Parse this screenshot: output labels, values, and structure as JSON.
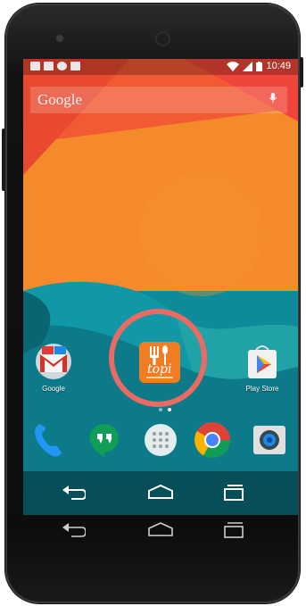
{
  "status_bar": {
    "time": "10:49",
    "left_icons": [
      "image-notification-icon",
      "email-notification-icon",
      "hangouts-notification-icon",
      "download-notification-icon"
    ],
    "right_icons": [
      "wifi-icon",
      "signal-icon",
      "battery-icon"
    ]
  },
  "search_bar": {
    "label": "Google",
    "icon": "mic-icon"
  },
  "home_apps": [
    {
      "name": "gmail-app",
      "label": "Google"
    },
    {
      "name": "topi-app",
      "label": "",
      "brand_text": "topi",
      "brand_color": "#f07d24"
    },
    {
      "name": "play-store-app",
      "label": "Play Store"
    }
  ],
  "dock_apps": [
    "phone-app",
    "hangouts-app",
    "app-drawer",
    "chrome-app",
    "camera-app"
  ],
  "nav_buttons": [
    "back-button",
    "home-button",
    "recents-button"
  ],
  "highlight_color": "#ea6b63",
  "colors": {
    "wallpaper_red": "#f25a34",
    "wallpaper_orange": "#f58a2c",
    "wallpaper_teal": "#0f8a98",
    "wallpaper_dark_teal": "#0a6572"
  }
}
